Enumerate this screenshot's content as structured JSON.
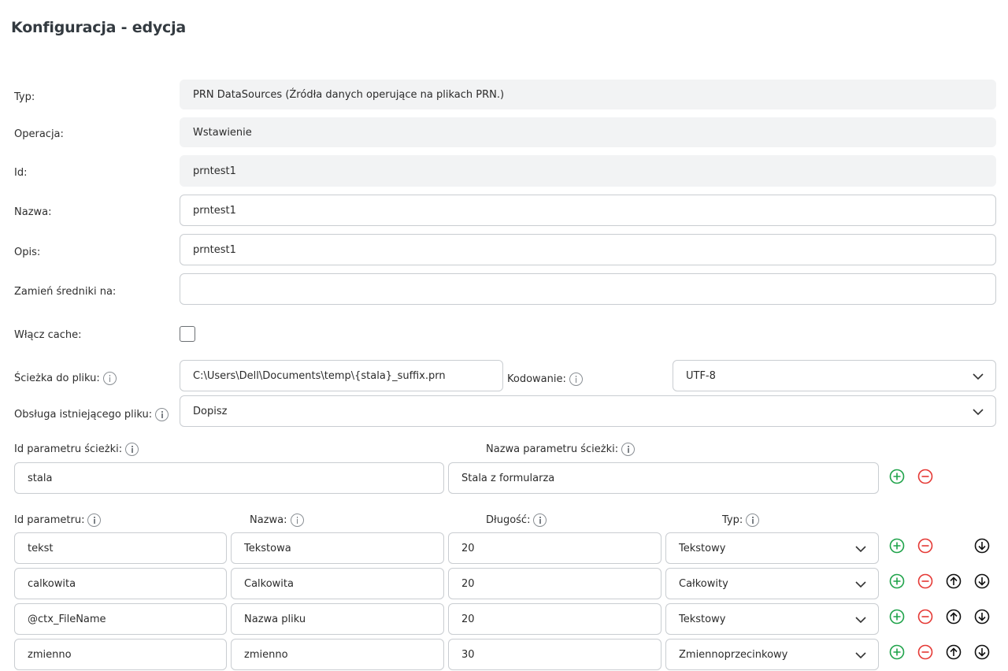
{
  "page": {
    "title": "Konfiguracja - edycja"
  },
  "form": {
    "typ_label": "Typ:",
    "typ_value": "PRN DataSources (Źródła danych operujące na plikach PRN.)",
    "operacja_label": "Operacja:",
    "operacja_value": "Wstawienie",
    "id_label": "Id:",
    "id_value": "prntest1",
    "nazwa_label": "Nazwa:",
    "nazwa_value": "prntest1",
    "opis_label": "Opis:",
    "opis_value": "prntest1",
    "zamien_label": "Zamień średniki na:",
    "zamien_value": "",
    "cache_label": "Włącz cache:",
    "cache_checked": false,
    "sciezka_label": "Ścieżka do pliku:",
    "sciezka_value": "C:\\Users\\Dell\\Documents\\temp\\{stala}_suffix.prn",
    "kodowanie_label": "Kodowanie:",
    "kodowanie_value": "UTF-8",
    "obsluga_label": "Obsługa istniejącego pliku:",
    "obsluga_value": "Dopisz"
  },
  "path_params": {
    "id_header": "Id parametru ścieżki:",
    "name_header": "Nazwa parametru ścieżki:",
    "rows": [
      {
        "id": "stala",
        "name": "Stala z formularza"
      }
    ]
  },
  "params": {
    "headers": {
      "id": "Id parametru:",
      "name": "Nazwa:",
      "length": "Długość:",
      "type": "Typ:"
    },
    "rows": [
      {
        "id": "tekst",
        "name": "Tekstowa",
        "length": "20",
        "type": "Tekstowy"
      },
      {
        "id": "calkowita",
        "name": "Calkowita",
        "length": "20",
        "type": "Całkowity"
      },
      {
        "id": "@ctx_FileName",
        "name": "Nazwa pliku",
        "length": "20",
        "type": "Tekstowy"
      },
      {
        "id": "zmienno",
        "name": "zmienno",
        "length": "30",
        "type": "Zmiennoprzecinkowy"
      }
    ]
  },
  "colors": {
    "add": "#1fa34a",
    "remove": "#e53935",
    "readonly_bg": "#f2f3f4",
    "border": "#c9cdd1"
  },
  "icons": [
    "info-icon",
    "chevron-down-icon",
    "plus-circle-icon",
    "minus-circle-icon",
    "arrow-up-circle-icon",
    "arrow-down-circle-icon"
  ]
}
